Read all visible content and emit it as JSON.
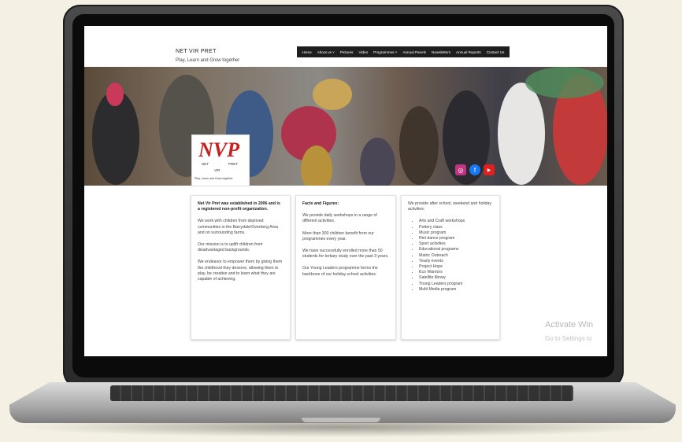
{
  "site": {
    "title": "NET VIR PRET",
    "tagline": "Play, Learn and Grow together"
  },
  "nav": {
    "items": [
      {
        "label": "Home"
      },
      {
        "label": "About us ˅"
      },
      {
        "label": "Pictures"
      },
      {
        "label": "Video"
      },
      {
        "label": "Programmes ˅"
      },
      {
        "label": "Annual Panels"
      },
      {
        "label": "Newsletters"
      },
      {
        "label": "Annual Reports"
      },
      {
        "label": "Contact Us"
      }
    ]
  },
  "logo": {
    "main": "NVP",
    "net": "NET",
    "vir": "VIR",
    "pret": "PRET",
    "tagline": "Play, Learn and Grow together"
  },
  "social": [
    {
      "icon": "instagram-icon",
      "glyph": "◎",
      "color": "#c13584"
    },
    {
      "icon": "facebook-icon",
      "glyph": "f",
      "color": "#1877f2"
    },
    {
      "icon": "youtube-icon",
      "glyph": "▶",
      "color": "#e02020"
    }
  ],
  "cards": {
    "about": {
      "p1": "Net Vir Pret was established in 2006 and is a registered non-profit organization.",
      "p2": "We work with children from deprived communities in the Barrydale/Overberg Area and on surrounding farms.",
      "p3": "Our mission is to uplift children from disadvantaged backgrounds.",
      "p4": "We endeavor to empower them by giving them the childhood they deserve, allowing them to play, be creative and to learn what they are capable of achieving."
    },
    "facts": {
      "heading": "Facts and Figures:",
      "p1": "We provide daily workshops in a range of different activities.",
      "p2": "More than 300 children benefit from our programmes every year.",
      "p3": "We have successfully enrolled more than 50 students for tertiary study over the past 3 years.",
      "p4": "Our Young Leaders programme forms the backbone of our holiday school activities."
    },
    "activities": {
      "intro": "We provide after school, weekend and holiday activities:",
      "items": [
        "Arts and Craft workshops",
        "Pottery class",
        "Music program",
        "Riel dance program",
        "Sport activities",
        "Educational programs",
        "Matric Outreach",
        "Yearly events",
        "Project Hope",
        "Eco Warriors",
        "Satellite library",
        "Young Leaders program",
        "Multi Media program"
      ]
    }
  },
  "watermark": {
    "line1": "Activate Win",
    "line2": "Go to Settings to"
  }
}
